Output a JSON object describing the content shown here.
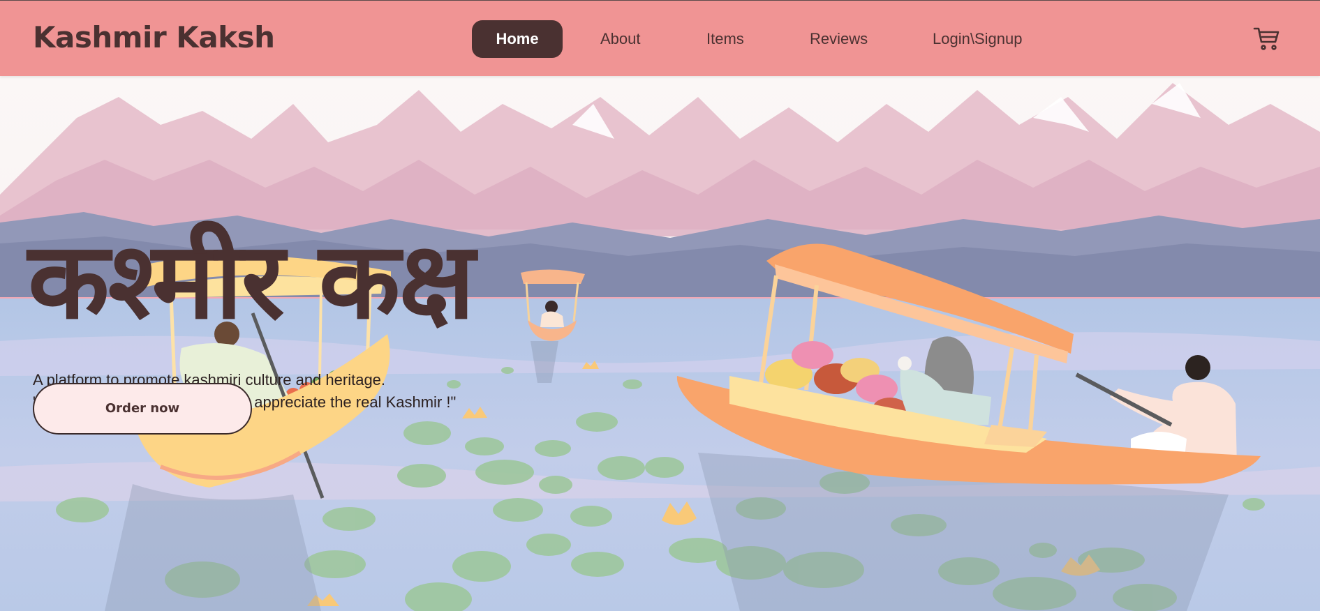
{
  "navbar": {
    "brand": "Kashmir Kaksh",
    "items": [
      {
        "label": "Home",
        "active": true
      },
      {
        "label": "About"
      },
      {
        "label": "Items"
      },
      {
        "label": "Reviews"
      },
      {
        "label": "Login\\Signup"
      }
    ],
    "cart_icon": "cart-icon"
  },
  "hero": {
    "title": "कश्मीर कक्ष",
    "tagline": "A platform to promote kashmiri culture and heritage.",
    "quote": "\"Let the world acknowledge and appreciate the real Kashmir !\"",
    "cta_label": "Order now"
  },
  "colors": {
    "navbar": "#f09494",
    "brand_text": "#4a3131",
    "active_pill": "#4a3131",
    "cta_bg": "#fdeaea"
  }
}
